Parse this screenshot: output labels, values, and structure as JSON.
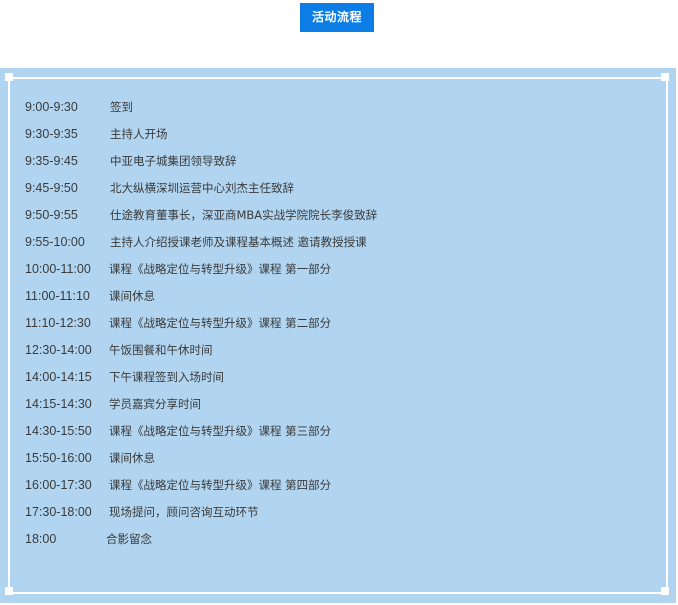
{
  "header": {
    "tag_label": "活动流程"
  },
  "colors": {
    "tag_bg": "#0d7de6",
    "panel_bg": "#b1d5f1",
    "frame": "#ffffff"
  },
  "schedule": [
    {
      "time": "9:00-9:30",
      "desc": "签到"
    },
    {
      "time": "9:30-9:35",
      "desc": "主持人开场"
    },
    {
      "time": "9:35-9:45",
      "desc": "中亚电子城集团领导致辞"
    },
    {
      "time": "9:45-9:50",
      "desc": "北大纵横深圳运营中心刘杰主任致辞"
    },
    {
      "time": "9:50-9:55",
      "desc": "仕途教育董事长，深亚商MBA实战学院院长李俊致辞"
    },
    {
      "time": "9:55-10:00",
      "desc": "主持人介绍授课老师及课程基本概述 邀请教授授课"
    },
    {
      "time": "10:00-11:00",
      "desc": "课程《战略定位与转型升级》课程 第一部分"
    },
    {
      "time": "11:00-11:10",
      "desc": "课间休息"
    },
    {
      "time": "11:10-12:30",
      "desc": "课程《战略定位与转型升级》课程 第二部分"
    },
    {
      "time": "12:30-14:00",
      "desc": "午饭围餐和午休时间"
    },
    {
      "time": "14:00-14:15",
      "desc": "下午课程签到入场时间"
    },
    {
      "time": "14:15-14:30",
      "desc": "学员嘉宾分享时间"
    },
    {
      "time": "14:30-15:50",
      "desc": "课程《战略定位与转型升级》课程 第三部分"
    },
    {
      "time": "15:50-16:00",
      "desc": "课间休息"
    },
    {
      "time": "16:00-17:30",
      "desc": "课程《战略定位与转型升级》课程 第四部分"
    },
    {
      "time": "17:30-18:00",
      "desc": "现场提问，顾问咨询互动环节"
    },
    {
      "time": "18:00",
      "desc": "合影留念"
    }
  ]
}
